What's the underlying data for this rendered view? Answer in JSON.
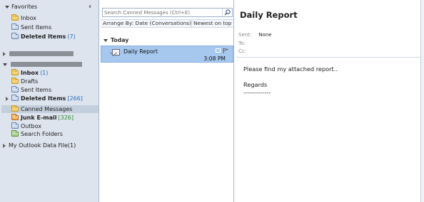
{
  "nav": {
    "favorites_label": "Favorites",
    "favorites": [
      {
        "label": "Inbox",
        "count": ""
      },
      {
        "label": "Sent Items",
        "count": ""
      },
      {
        "label": "Deleted Items",
        "count": "(7)"
      }
    ],
    "mailbox_items": [
      {
        "label": "Inbox",
        "count": "(1)"
      },
      {
        "label": "Drafts",
        "count": ""
      },
      {
        "label": "Sent Items",
        "count": ""
      },
      {
        "label": "Deleted Items",
        "count": "[266]"
      },
      {
        "label": "Canned Messages",
        "count": ""
      },
      {
        "label": "Junk E-mail",
        "count": "[326]"
      },
      {
        "label": "Outbox",
        "count": ""
      },
      {
        "label": "Search Folders",
        "count": ""
      }
    ],
    "data_file_label": "My Outlook Data File(1)",
    "collapse_glyph": "‹"
  },
  "list": {
    "search_placeholder": "Search Canned Messages (Ctrl+E)",
    "arrange_by": "Arrange By: Date (Conversations)",
    "sort_order": "Newest on top",
    "group_label": "Today",
    "message": {
      "subject": "Daily Report",
      "time": "3:08 PM"
    }
  },
  "reading": {
    "title": "Daily Report",
    "sent_label": "Sent:",
    "sent_value": "None",
    "to_label": "To:",
    "cc_label": "Cc:",
    "body": [
      "Please find my attached report..",
      "Regards",
      "-------------"
    ]
  },
  "colors": {
    "selected_message": "#a7c8ee",
    "nav_background": "#dde4ee",
    "count_blue": "#2c6cc0",
    "count_green": "#2e8b2e"
  }
}
